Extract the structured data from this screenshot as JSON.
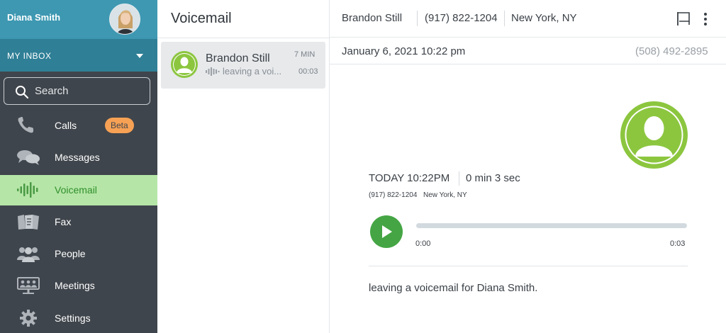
{
  "user": {
    "name": "Diana Smith"
  },
  "inbox": {
    "label": "MY INBOX"
  },
  "search": {
    "placeholder": "Search"
  },
  "nav": [
    {
      "label": "Calls",
      "icon": "phone-icon",
      "badge": "Beta"
    },
    {
      "label": "Messages",
      "icon": "chat-bubbles-icon"
    },
    {
      "label": "Voicemail",
      "icon": "voicemail-waveform-icon",
      "active": true
    },
    {
      "label": "Fax",
      "icon": "fax-icon"
    },
    {
      "label": "People",
      "icon": "people-icon"
    },
    {
      "label": "Meetings",
      "icon": "meetings-icon"
    },
    {
      "label": "Settings",
      "icon": "gear-icon"
    }
  ],
  "list": {
    "title": "Voicemail",
    "items": [
      {
        "name": "Brandon Still",
        "duration": "7 MIN",
        "preview": "leaving a voi...",
        "time": "00:03"
      }
    ]
  },
  "detail": {
    "header": {
      "name": "Brandon Still",
      "phone": "(917) 822-1204",
      "location": "New York, NY"
    },
    "date": "January 6, 2021 10:22 pm",
    "from_number": "(508) 492-2895",
    "timestamp": "TODAY 10:22PM",
    "duration": "0 min 3 sec",
    "caller_phone": "(917) 822-1204",
    "caller_location": "New York, NY",
    "player": {
      "start": "0:00",
      "end": "0:03",
      "progress": 0
    },
    "transcript": "leaving a voicemail for Diana Smith."
  },
  "colors": {
    "sidebar_bg": "#3f454c",
    "sidebar_top": "#3e98b2",
    "inbox_bar": "#2f7f96",
    "active_nav": "#b5e6a7",
    "accent_green": "#45a544",
    "avatar_green": "#8cc63f",
    "beta_badge": "#f7a155"
  }
}
